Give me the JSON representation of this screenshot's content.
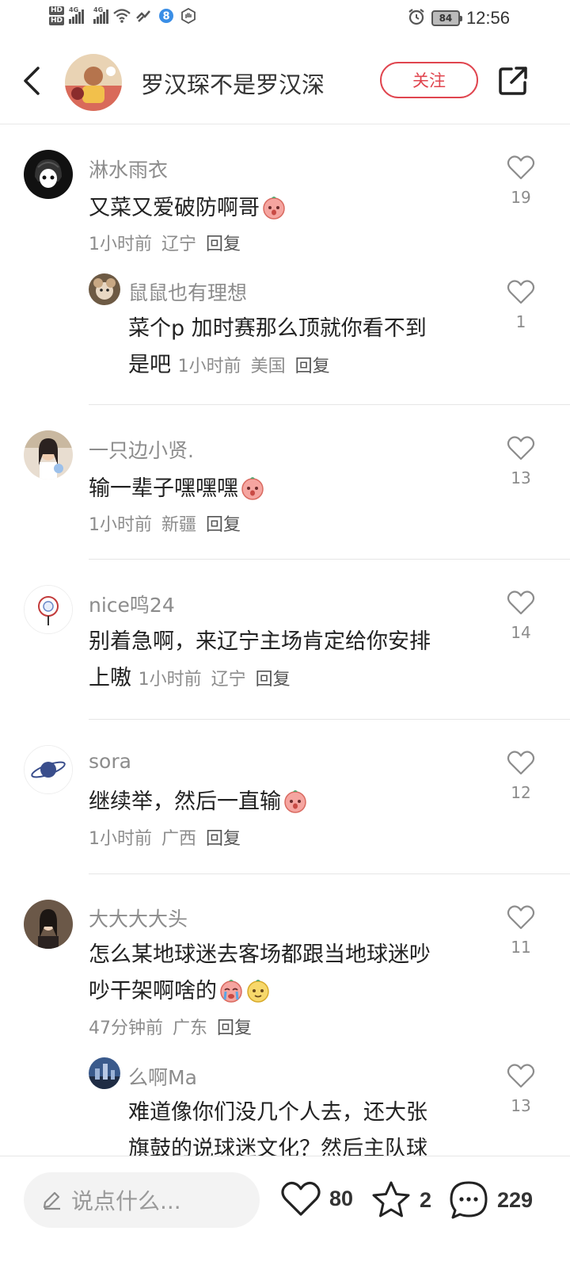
{
  "status_bar": {
    "hd1": "HD",
    "hd2": "HD",
    "net1": "4G",
    "net2": "4G",
    "notification_badge": "8",
    "battery": "84",
    "time": "12:56"
  },
  "header": {
    "title": "罗汉琛不是罗汉深",
    "follow_label": "关注"
  },
  "comments": [
    {
      "user": "淋水雨衣",
      "text": "又菜又爱破防啊哥",
      "time": "1小时前",
      "location": "辽宁",
      "reply": "回复",
      "likes": "19"
    },
    {
      "user": "鼠鼠也有理想",
      "text_line1": "菜个p 加时赛那么顶就你看不到",
      "text_line2": "是吧",
      "time": "1小时前",
      "location": "美国",
      "reply": "回复",
      "likes": "1"
    },
    {
      "user": "一只边小贤.",
      "text": "输一辈子嘿嘿嘿",
      "time": "1小时前",
      "location": "新疆",
      "reply": "回复",
      "likes": "13"
    },
    {
      "user": "nice鸣24",
      "text_line1": "别着急啊，来辽宁主场肯定给你安排",
      "text_line2": "上嗷",
      "time": "1小时前",
      "location": "辽宁",
      "reply": "回复",
      "likes": "14"
    },
    {
      "user": "sora",
      "text": "继续举，然后一直输",
      "time": "1小时前",
      "location": "广西",
      "reply": "回复",
      "likes": "12"
    },
    {
      "user": "大大大大头",
      "text_line1": "怎么某地球迷去客场都跟当地球迷吵",
      "text_line2": "吵干架啊啥的",
      "time": "47分钟前",
      "location": "广东",
      "reply": "回复",
      "likes": "11"
    },
    {
      "user": "么啊Ma",
      "text_line1": "难道像你们没几个人去，还大张",
      "text_line2": "旗鼓的说球迷文化？然后主队球",
      "likes": "13"
    }
  ],
  "bottom_bar": {
    "input_placeholder": "说点什么...",
    "like_count": "80",
    "fav_count": "2",
    "comment_count": "229"
  }
}
